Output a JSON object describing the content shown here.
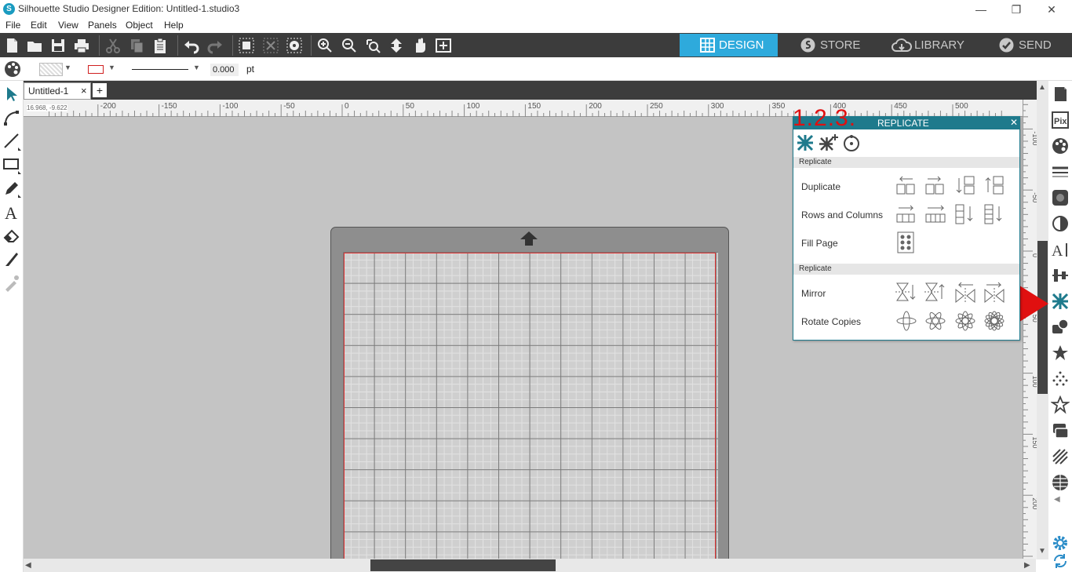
{
  "window": {
    "title": "Silhouette Studio Designer Edition: Untitled-1.studio3",
    "controls": [
      "—",
      "❐",
      "✕"
    ]
  },
  "menubar": [
    "File",
    "Edit",
    "View",
    "Panels",
    "Object",
    "Help"
  ],
  "nav_tabs": [
    {
      "label": "DESIGN",
      "icon": "grid-icon",
      "active": true
    },
    {
      "label": "STORE",
      "icon": "silhouette-s-icon",
      "active": false
    },
    {
      "label": "LIBRARY",
      "icon": "cloud-icon",
      "active": false
    },
    {
      "label": "SEND",
      "icon": "checkmark-icon",
      "active": false
    }
  ],
  "properties": {
    "line_width_value": "0.000",
    "line_width_unit": "pt"
  },
  "document_tab": {
    "name": "Untitled-1",
    "close": "×",
    "add": "+"
  },
  "ruler": {
    "horizontal_ticks": [
      "-200",
      "-150",
      "-100",
      "-50",
      "0",
      "50",
      "100",
      "150",
      "200",
      "250",
      "300",
      "350",
      "400",
      "450",
      "500"
    ],
    "vertical_ticks": [
      "-100",
      "-50",
      "0",
      "50",
      "100",
      "150",
      "200"
    ],
    "coordinates": "16.968, -9.622"
  },
  "replicate_panel": {
    "title": "REPLICATE",
    "close": "✕",
    "annotation": "1.2.3.",
    "sections": [
      {
        "header": "Replicate",
        "rows": [
          {
            "label": "Duplicate",
            "buttons": 4
          },
          {
            "label": "Rows and Columns",
            "buttons": 4
          },
          {
            "label": "Fill Page",
            "buttons": 1
          }
        ]
      },
      {
        "header": "Replicate",
        "rows": [
          {
            "label": "Mirror",
            "buttons": 4
          },
          {
            "label": "Rotate Copies",
            "buttons": 4
          }
        ]
      }
    ]
  },
  "colors": {
    "accent": "#2eaadc",
    "panel_header": "#1e7a8c",
    "toolbar": "#3c3c3c",
    "canvas": "#c4c4c4",
    "mat": "#8e8e8e",
    "cut_line": "#e03030",
    "annotation": "#e01010"
  }
}
